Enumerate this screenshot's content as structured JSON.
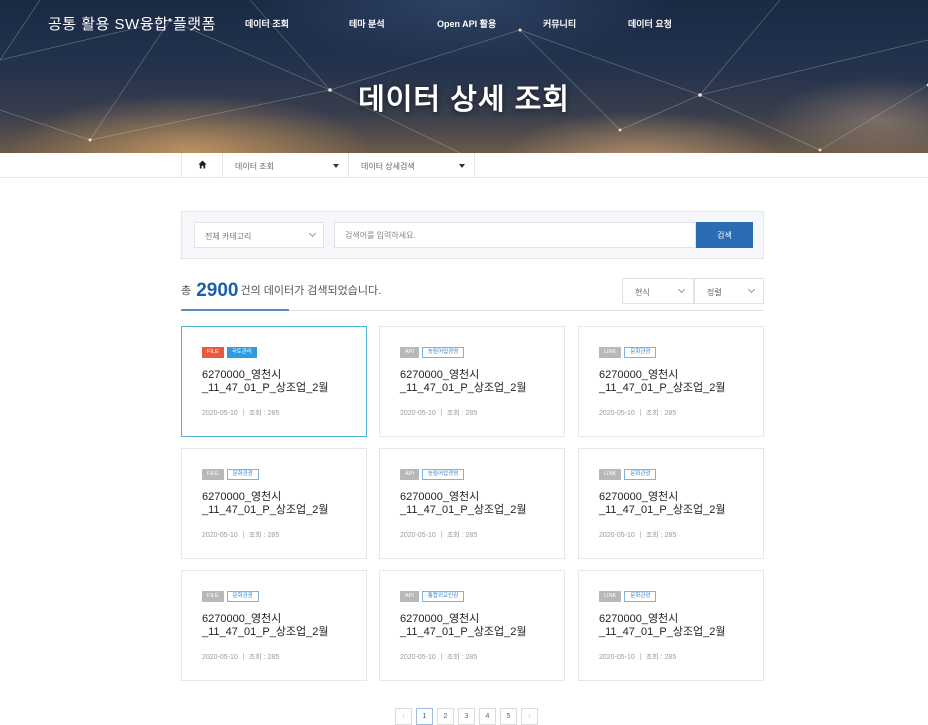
{
  "header": {
    "brand": "공통 활용 SW융합 플랫폼",
    "nav": [
      "데이터 조회",
      "테마 분석",
      "Open API 활용",
      "커뮤니티",
      "데이터 요청"
    ],
    "page_title": "데이터 상세 조회"
  },
  "breadcrumb": {
    "home_icon": "home-icon",
    "level1": "데이터 조회",
    "level2": "데이터 상세검색"
  },
  "search": {
    "category_label": "전체 카테고리",
    "placeholder": "검색어를 입력하세요.",
    "button_label": "검색"
  },
  "results": {
    "prefix": "총",
    "count": "2900",
    "suffix": "건의 데이터가 검색되었습니다.",
    "sort_order": "현식",
    "sort_by": "정렬"
  },
  "cards": [
    {
      "format": "FILE",
      "category": "국토관리",
      "title": "6270000_영천시_11_47_01_P_상조업_2월",
      "date": "2020-05-10",
      "views": "조회 : 285"
    },
    {
      "format": "API",
      "category": "농림어업경영",
      "title": "6270000_영천시_11_47_01_P_상조업_2월",
      "date": "2020-05-10",
      "views": "조회 : 285"
    },
    {
      "format": "LINK",
      "category": "문화관광",
      "title": "6270000_영천시_11_47_01_P_상조업_2월",
      "date": "2020-05-10",
      "views": "조회 : 285"
    },
    {
      "format": "FILE",
      "category": "문화관광",
      "title": "6270000_영천시_11_47_01_P_상조업_2월",
      "date": "2020-05-10",
      "views": "조회 : 285"
    },
    {
      "format": "API",
      "category": "농림어업경영",
      "title": "6270000_영천시_11_47_01_P_상조업_2월",
      "date": "2020-05-10",
      "views": "조회 : 285"
    },
    {
      "format": "LINK",
      "category": "문화관광",
      "title": "6270000_영천시_11_47_01_P_상조업_2월",
      "date": "2020-05-10",
      "views": "조회 : 285"
    },
    {
      "format": "FILE",
      "category": "문화관광",
      "title": "6270000_영천시_11_47_01_P_상조업_2월",
      "date": "2020-05-10",
      "views": "조회 : 285"
    },
    {
      "format": "API",
      "category": "통합외교인권",
      "title": "6270000_영천시_11_47_01_P_상조업_2월",
      "date": "2020-05-10",
      "views": "조회 : 285"
    },
    {
      "format": "LINK",
      "category": "문화관광",
      "title": "6270000_영천시_11_47_01_P_상조업_2월",
      "date": "2020-05-10",
      "views": "조회 : 285"
    }
  ],
  "pagination": {
    "prev": "‹",
    "pages": [
      "1",
      "2",
      "3",
      "4",
      "5"
    ],
    "current": "1",
    "next": "›"
  },
  "colors": {
    "accent": "#2a6db5",
    "count_blue": "#1d5fa8",
    "file_badge": "#e8593f",
    "category_solid": "#2f9be0",
    "active_card_border": "#52b3d9"
  }
}
